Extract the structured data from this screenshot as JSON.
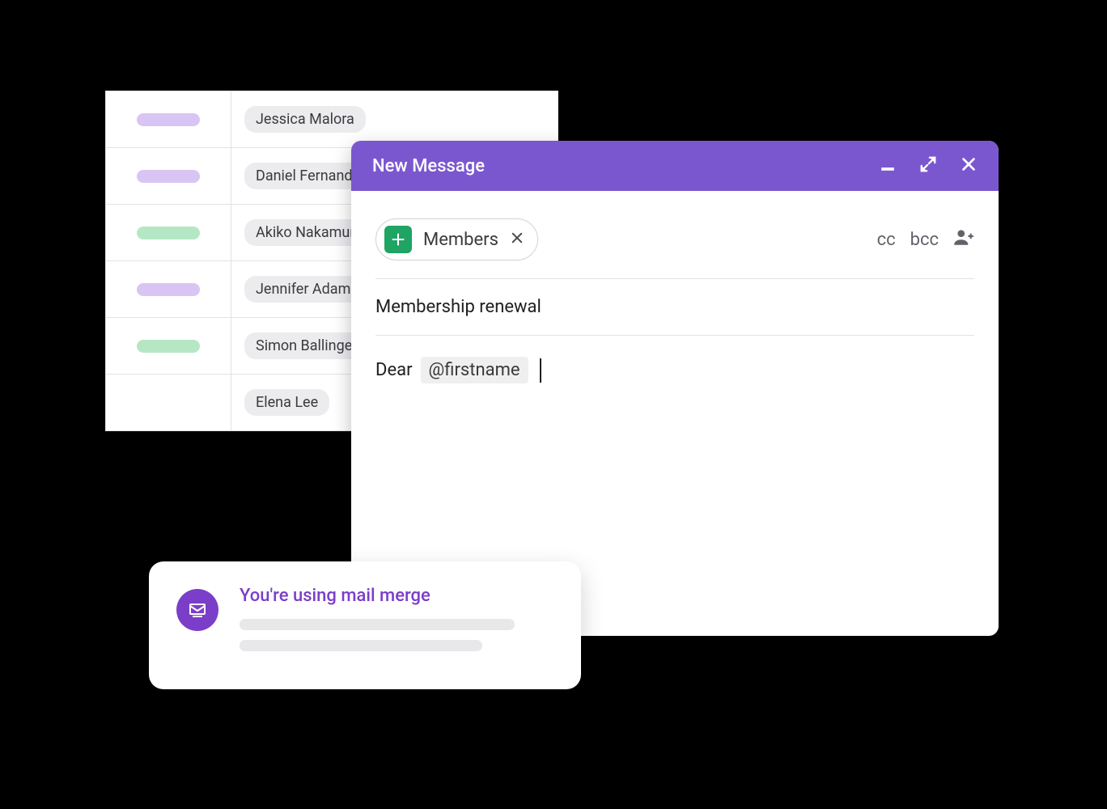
{
  "sheet": {
    "rows": [
      {
        "status_color": "purple",
        "name": "Jessica Malora"
      },
      {
        "status_color": "purple",
        "name": "Daniel Fernandez"
      },
      {
        "status_color": "green",
        "name": "Akiko Nakamura"
      },
      {
        "status_color": "purple",
        "name": "Jennifer Adams"
      },
      {
        "status_color": "green",
        "name": "Simon Ballinger"
      },
      {
        "status_color": "",
        "name": "Elena Lee"
      }
    ]
  },
  "compose": {
    "title": "New Message",
    "recipient_chip": "Members",
    "cc_label": "cc",
    "bcc_label": "bcc",
    "subject": "Membership renewal",
    "body_prefix": "Dear",
    "merge_token": "@firstname"
  },
  "notice": {
    "title": "You're using mail merge"
  },
  "colors": {
    "brand_purple": "#7b57cf",
    "accent_purple": "#7b3ec9",
    "sheets_green": "#1fa463"
  }
}
